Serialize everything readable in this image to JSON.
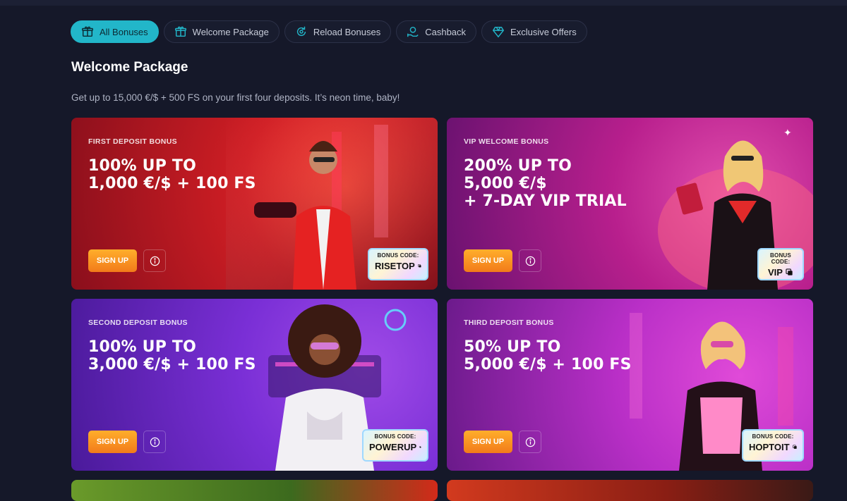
{
  "tabs": [
    {
      "label": "All Bonuses",
      "icon": "gift-icon",
      "active": true
    },
    {
      "label": "Welcome Package",
      "icon": "gift-icon",
      "active": false
    },
    {
      "label": "Reload Bonuses",
      "icon": "reload-icon",
      "active": false
    },
    {
      "label": "Cashback",
      "icon": "cashback-icon",
      "active": false
    },
    {
      "label": "Exclusive Offers",
      "icon": "diamond-icon",
      "active": false
    }
  ],
  "section": {
    "title": "Welcome Package",
    "description": "Get up to 15,000 €/$ + 500 FS on your first four deposits. It’s neon time, baby!"
  },
  "cards": [
    {
      "kicker": "FIRST DEPOSIT BONUS",
      "lines": [
        "100% UP TO",
        "1,000 €/$ + 100 FS"
      ],
      "signup": "SIGN UP",
      "code_label": "BONUS CODE:",
      "code": "RISETOP",
      "colors": {
        "from": "#d01e24",
        "to": "#7a0f1c",
        "art": "#3a1020"
      }
    },
    {
      "kicker": "VIP WELCOME BONUS",
      "lines": [
        "200% UP TO",
        "5,000 €/$",
        "+ 7-DAY VIP TRIAL"
      ],
      "signup": "SIGN UP",
      "code_label": "BONUS CODE:",
      "code": "VIP",
      "colors": {
        "from": "#b81f8d",
        "to": "#7d1580",
        "art": "#3b0d3a"
      }
    },
    {
      "kicker": "SECOND DEPOSIT BONUS",
      "lines": [
        "100% UP TO",
        "3,000 €/$ + 100 FS"
      ],
      "signup": "SIGN UP",
      "code_label": "BONUS CODE:",
      "code": "POWERUP",
      "colors": {
        "from": "#7a2fd6",
        "to": "#5a1fb0",
        "art": "#2a1650"
      }
    },
    {
      "kicker": "THIRD DEPOSIT BONUS",
      "lines": [
        "50% UP TO",
        "5,000 €/$ + 100 FS"
      ],
      "signup": "SIGN UP",
      "code_label": "BONUS CODE:",
      "code": "HOPTOIT",
      "colors": {
        "from": "#b92fc7",
        "to": "#8322a8",
        "art": "#3c1246"
      }
    },
    {
      "kicker": "",
      "lines": [],
      "colors": {
        "from": "#6a9a2a",
        "to": "#3c6a1e",
        "art": "#2e3a18"
      }
    },
    {
      "kicker": "",
      "lines": [],
      "colors": {
        "from": "#d23a1e",
        "to": "#8a1e14",
        "art": "#3a1a16"
      }
    }
  ]
}
